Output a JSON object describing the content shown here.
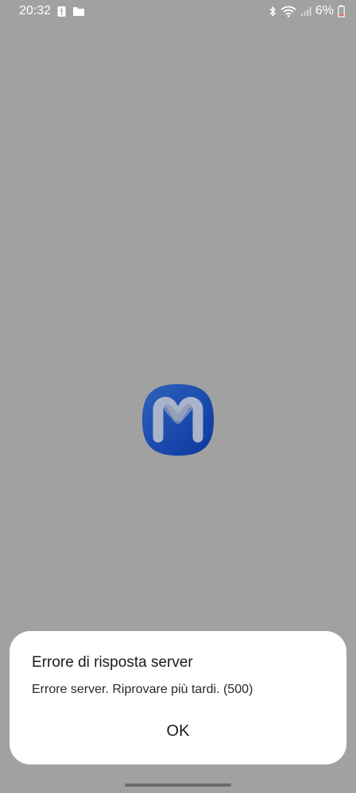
{
  "status_bar": {
    "time": "20:32",
    "battery_percent": "6%",
    "battery_level": 0.06,
    "icons_left": [
      "alert-icon",
      "folder-icon"
    ],
    "icons_right": [
      "bluetooth-icon",
      "wifi-icon",
      "signal-icon",
      "battery-icon"
    ]
  },
  "app": {
    "logo_icon": "app-logo-m-icon",
    "logo_color": "#0b3fa8"
  },
  "dialog": {
    "title": "Errore di risposta server",
    "message": "Errore server. Riprovare più tardi. (500)",
    "ok_label": "OK"
  }
}
